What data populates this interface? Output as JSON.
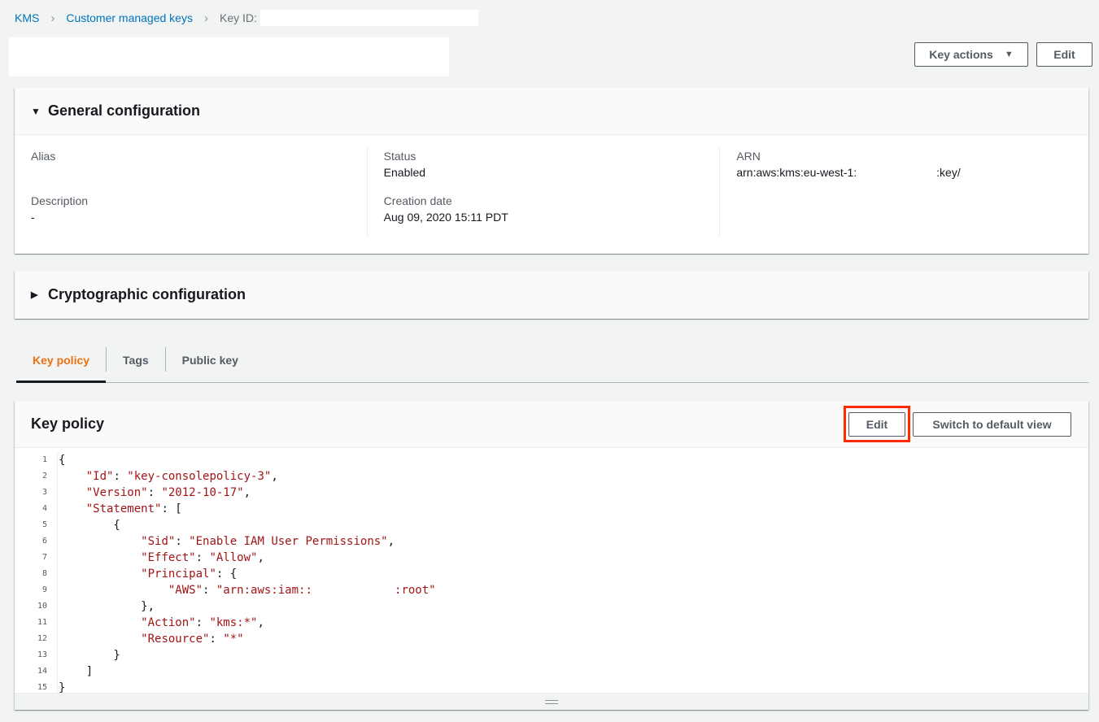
{
  "breadcrumb": {
    "kms": "KMS",
    "customer_keys": "Customer managed keys",
    "key_id_label": "Key ID:"
  },
  "header": {
    "key_actions_label": "Key actions",
    "edit_label": "Edit"
  },
  "general": {
    "title": "General configuration",
    "alias_label": "Alias",
    "alias_value": "",
    "description_label": "Description",
    "description_value": "-",
    "status_label": "Status",
    "status_value": "Enabled",
    "creation_label": "Creation date",
    "creation_value": "Aug 09, 2020 15:11 PDT",
    "arn_label": "ARN",
    "arn_prefix": "arn:aws:kms:eu-west-1:",
    "arn_suffix": ":key/"
  },
  "crypto": {
    "title": "Cryptographic configuration"
  },
  "tabs": [
    "Key policy",
    "Tags",
    "Public key"
  ],
  "policy": {
    "title": "Key policy",
    "edit_label": "Edit",
    "switch_label": "Switch to default view",
    "lines": [
      "{",
      "    \"Id\": \"key-consolepolicy-3\",",
      "    \"Version\": \"2012-10-17\",",
      "    \"Statement\": [",
      "        {",
      "            \"Sid\": \"Enable IAM User Permissions\",",
      "            \"Effect\": \"Allow\",",
      "            \"Principal\": {",
      "                \"AWS\": \"arn:aws:iam::            :root\"",
      "            },",
      "            \"Action\": \"kms:*\",",
      "            \"Resource\": \"*\"",
      "        }",
      "    ]",
      "}"
    ]
  }
}
